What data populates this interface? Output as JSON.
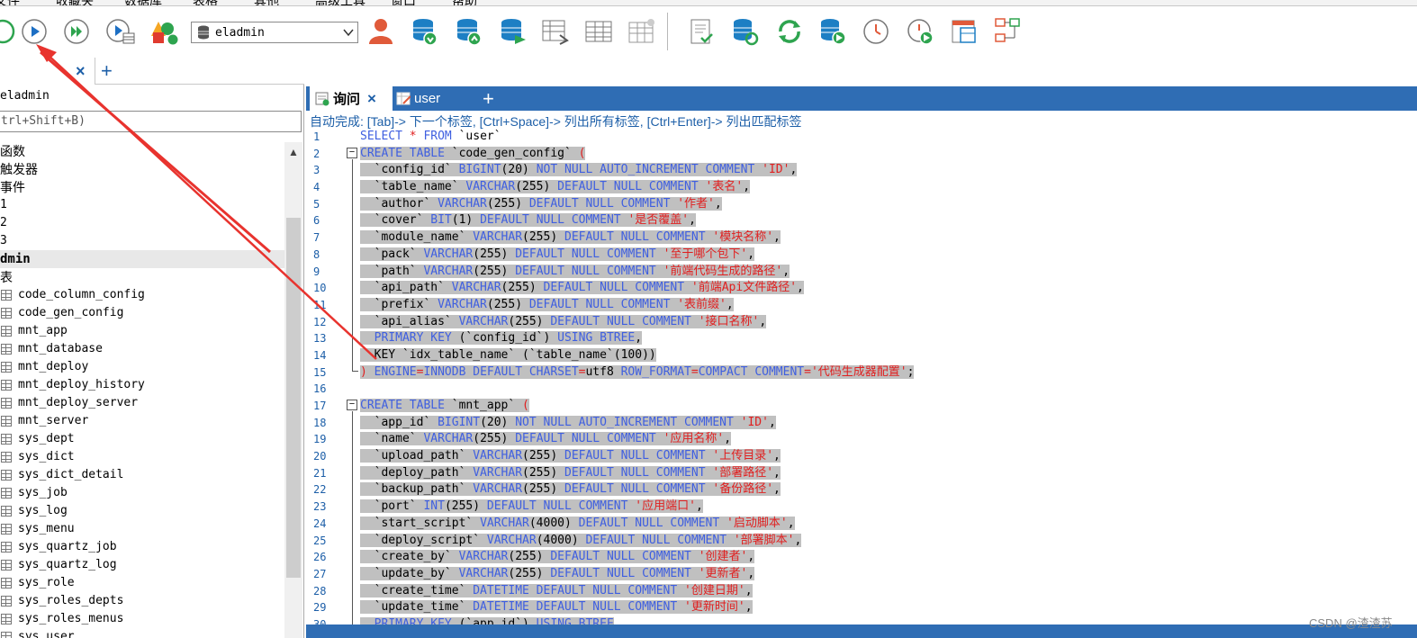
{
  "menubar": {
    "items": [
      "文件",
      "收藏夹",
      "数据库",
      "表格",
      "其他",
      "高级工具",
      "窗口",
      "帮助"
    ]
  },
  "toolbar": {
    "database_select": "eladmin",
    "icons": [
      "refresh-icon",
      "run-icon",
      "run-all-icon",
      "explain-icon",
      "shapes-icon",
      "user-icon",
      "db-import-icon",
      "db-export-icon",
      "db-sync-icon",
      "table-arrow-icon",
      "table-grid-icon",
      "table-star-icon",
      "doc-check-icon",
      "db-refresh-icon",
      "sync-icon",
      "db-add-icon",
      "clock-icon",
      "schedule-icon",
      "layout-icon",
      "diagram-icon"
    ]
  },
  "tabstrip2": {
    "close": "×",
    "plus": "+"
  },
  "left_panel": {
    "connection": "eladmin",
    "filter_placeholder": "trl+Shift+B)",
    "tree": [
      {
        "label": "函数",
        "style": "cjk"
      },
      {
        "label": "触发器",
        "style": "cjk"
      },
      {
        "label": "事件",
        "style": "cjk"
      },
      {
        "label": "1",
        "style": "mono"
      },
      {
        "label": "2",
        "style": "mono"
      },
      {
        "label": "3",
        "style": "mono"
      },
      {
        "label": "dmin",
        "style": "bold"
      },
      {
        "label": "表",
        "style": "cjk"
      },
      {
        "label": "code_column_config",
        "style": "table"
      },
      {
        "label": "code_gen_config",
        "style": "table"
      },
      {
        "label": "mnt_app",
        "style": "table"
      },
      {
        "label": "mnt_database",
        "style": "table"
      },
      {
        "label": "mnt_deploy",
        "style": "table"
      },
      {
        "label": "mnt_deploy_history",
        "style": "table"
      },
      {
        "label": "mnt_deploy_server",
        "style": "table"
      },
      {
        "label": "mnt_server",
        "style": "table"
      },
      {
        "label": "sys_dept",
        "style": "table"
      },
      {
        "label": "sys_dict",
        "style": "table"
      },
      {
        "label": "sys_dict_detail",
        "style": "table"
      },
      {
        "label": "sys_job",
        "style": "table"
      },
      {
        "label": "sys_log",
        "style": "table"
      },
      {
        "label": "sys_menu",
        "style": "table"
      },
      {
        "label": "sys_quartz_job",
        "style": "table"
      },
      {
        "label": "sys_quartz_log",
        "style": "table"
      },
      {
        "label": "sys_role",
        "style": "table"
      },
      {
        "label": "sys_roles_depts",
        "style": "table"
      },
      {
        "label": "sys_roles_menus",
        "style": "table"
      },
      {
        "label": "sys_user",
        "style": "table"
      }
    ]
  },
  "editor_tabs": {
    "active": "询问",
    "active_close": "×",
    "second": "user",
    "plus": "+"
  },
  "hint": "自动完成: [Tab]-> 下一个标签, [Ctrl+Space]-> 列出所有标签, [Ctrl+Enter]-> 列出匹配标签",
  "code_lines": [
    {
      "n": "1",
      "sel": false,
      "parts": [
        [
          "k",
          "SELECT "
        ],
        [
          "s",
          "* "
        ],
        [
          "k",
          "FROM "
        ],
        [
          "p",
          "`user`"
        ]
      ]
    },
    {
      "n": "2",
      "sel": true,
      "parts": [
        [
          "k",
          "CREATE TABLE "
        ],
        [
          "p",
          "`code_gen_config` "
        ],
        [
          "s",
          "("
        ]
      ]
    },
    {
      "n": "3",
      "sel": true,
      "parts": [
        [
          "p",
          "  `config_id` "
        ],
        [
          "k",
          "BIGINT"
        ],
        [
          "p",
          "(20) "
        ],
        [
          "k",
          "NOT NULL AUTO_INCREMENT COMMENT "
        ],
        [
          "s",
          "'ID'"
        ],
        [
          "p",
          ","
        ]
      ]
    },
    {
      "n": "4",
      "sel": true,
      "parts": [
        [
          "p",
          "  `table_name` "
        ],
        [
          "k",
          "VARCHAR"
        ],
        [
          "p",
          "(255) "
        ],
        [
          "k",
          "DEFAULT NULL COMMENT "
        ],
        [
          "s",
          "'表名'"
        ],
        [
          "p",
          ","
        ]
      ]
    },
    {
      "n": "5",
      "sel": true,
      "parts": [
        [
          "p",
          "  `author` "
        ],
        [
          "k",
          "VARCHAR"
        ],
        [
          "p",
          "(255) "
        ],
        [
          "k",
          "DEFAULT NULL COMMENT "
        ],
        [
          "s",
          "'作者'"
        ],
        [
          "p",
          ","
        ]
      ]
    },
    {
      "n": "6",
      "sel": true,
      "parts": [
        [
          "p",
          "  `cover` "
        ],
        [
          "k",
          "BIT"
        ],
        [
          "p",
          "(1) "
        ],
        [
          "k",
          "DEFAULT NULL COMMENT "
        ],
        [
          "s",
          "'是否覆盖'"
        ],
        [
          "p",
          ","
        ]
      ]
    },
    {
      "n": "7",
      "sel": true,
      "parts": [
        [
          "p",
          "  `module_name` "
        ],
        [
          "k",
          "VARCHAR"
        ],
        [
          "p",
          "(255) "
        ],
        [
          "k",
          "DEFAULT NULL COMMENT "
        ],
        [
          "s",
          "'模块名称'"
        ],
        [
          "p",
          ","
        ]
      ]
    },
    {
      "n": "8",
      "sel": true,
      "parts": [
        [
          "p",
          "  `pack` "
        ],
        [
          "k",
          "VARCHAR"
        ],
        [
          "p",
          "(255) "
        ],
        [
          "k",
          "DEFAULT NULL COMMENT "
        ],
        [
          "s",
          "'至于哪个包下'"
        ],
        [
          "p",
          ","
        ]
      ]
    },
    {
      "n": "9",
      "sel": true,
      "parts": [
        [
          "p",
          "  `path` "
        ],
        [
          "k",
          "VARCHAR"
        ],
        [
          "p",
          "(255) "
        ],
        [
          "k",
          "DEFAULT NULL COMMENT "
        ],
        [
          "s",
          "'前端代码生成的路径'"
        ],
        [
          "p",
          ","
        ]
      ]
    },
    {
      "n": "10",
      "sel": true,
      "parts": [
        [
          "p",
          "  `api_path` "
        ],
        [
          "k",
          "VARCHAR"
        ],
        [
          "p",
          "(255) "
        ],
        [
          "k",
          "DEFAULT NULL COMMENT "
        ],
        [
          "s",
          "'前端Api文件路径'"
        ],
        [
          "p",
          ","
        ]
      ]
    },
    {
      "n": "11",
      "sel": true,
      "parts": [
        [
          "p",
          "  `prefix` "
        ],
        [
          "k",
          "VARCHAR"
        ],
        [
          "p",
          "(255) "
        ],
        [
          "k",
          "DEFAULT NULL COMMENT "
        ],
        [
          "s",
          "'表前缀'"
        ],
        [
          "p",
          ","
        ]
      ]
    },
    {
      "n": "12",
      "sel": true,
      "parts": [
        [
          "p",
          "  `api_alias` "
        ],
        [
          "k",
          "VARCHAR"
        ],
        [
          "p",
          "(255) "
        ],
        [
          "k",
          "DEFAULT NULL COMMENT "
        ],
        [
          "s",
          "'接口名称'"
        ],
        [
          "p",
          ","
        ]
      ]
    },
    {
      "n": "13",
      "sel": true,
      "parts": [
        [
          "k",
          "  PRIMARY KEY "
        ],
        [
          "p",
          "(`config_id`) "
        ],
        [
          "k",
          "USING BTREE"
        ],
        [
          "p",
          ","
        ]
      ]
    },
    {
      "n": "14",
      "sel": true,
      "parts": [
        [
          "p",
          "  KEY `idx_table_name` (`table_name`(100))"
        ]
      ]
    },
    {
      "n": "15",
      "sel": true,
      "parts": [
        [
          "s",
          ") "
        ],
        [
          "k",
          "ENGINE"
        ],
        [
          "s",
          "="
        ],
        [
          "k",
          "INNODB DEFAULT CHARSET"
        ],
        [
          "s",
          "="
        ],
        [
          "p",
          "utf8 "
        ],
        [
          "k",
          "ROW_FORMAT"
        ],
        [
          "s",
          "="
        ],
        [
          "k",
          "COMPACT COMMENT"
        ],
        [
          "s",
          "="
        ],
        [
          "s",
          "'代码生成器配置'"
        ],
        [
          "p",
          ";"
        ]
      ]
    },
    {
      "n": "16",
      "sel": false,
      "parts": [
        [
          "p",
          ""
        ]
      ]
    },
    {
      "n": "17",
      "sel": true,
      "parts": [
        [
          "k",
          "CREATE TABLE "
        ],
        [
          "p",
          "`mnt_app` "
        ],
        [
          "s",
          "("
        ]
      ]
    },
    {
      "n": "18",
      "sel": true,
      "parts": [
        [
          "p",
          "  `app_id` "
        ],
        [
          "k",
          "BIGINT"
        ],
        [
          "p",
          "(20) "
        ],
        [
          "k",
          "NOT NULL AUTO_INCREMENT COMMENT "
        ],
        [
          "s",
          "'ID'"
        ],
        [
          "p",
          ","
        ]
      ]
    },
    {
      "n": "19",
      "sel": true,
      "parts": [
        [
          "p",
          "  `name` "
        ],
        [
          "k",
          "VARCHAR"
        ],
        [
          "p",
          "(255) "
        ],
        [
          "k",
          "DEFAULT NULL COMMENT "
        ],
        [
          "s",
          "'应用名称'"
        ],
        [
          "p",
          ","
        ]
      ]
    },
    {
      "n": "20",
      "sel": true,
      "parts": [
        [
          "p",
          "  `upload_path` "
        ],
        [
          "k",
          "VARCHAR"
        ],
        [
          "p",
          "(255) "
        ],
        [
          "k",
          "DEFAULT NULL COMMENT "
        ],
        [
          "s",
          "'上传目录'"
        ],
        [
          "p",
          ","
        ]
      ]
    },
    {
      "n": "21",
      "sel": true,
      "parts": [
        [
          "p",
          "  `deploy_path` "
        ],
        [
          "k",
          "VARCHAR"
        ],
        [
          "p",
          "(255) "
        ],
        [
          "k",
          "DEFAULT NULL COMMENT "
        ],
        [
          "s",
          "'部署路径'"
        ],
        [
          "p",
          ","
        ]
      ]
    },
    {
      "n": "22",
      "sel": true,
      "parts": [
        [
          "p",
          "  `backup_path` "
        ],
        [
          "k",
          "VARCHAR"
        ],
        [
          "p",
          "(255) "
        ],
        [
          "k",
          "DEFAULT NULL COMMENT "
        ],
        [
          "s",
          "'备份路径'"
        ],
        [
          "p",
          ","
        ]
      ]
    },
    {
      "n": "23",
      "sel": true,
      "parts": [
        [
          "p",
          "  `port` "
        ],
        [
          "k",
          "INT"
        ],
        [
          "p",
          "(255) "
        ],
        [
          "k",
          "DEFAULT NULL COMMENT "
        ],
        [
          "s",
          "'应用端口'"
        ],
        [
          "p",
          ","
        ]
      ]
    },
    {
      "n": "24",
      "sel": true,
      "parts": [
        [
          "p",
          "  `start_script` "
        ],
        [
          "k",
          "VARCHAR"
        ],
        [
          "p",
          "(4000) "
        ],
        [
          "k",
          "DEFAULT NULL COMMENT "
        ],
        [
          "s",
          "'启动脚本'"
        ],
        [
          "p",
          ","
        ]
      ]
    },
    {
      "n": "25",
      "sel": true,
      "parts": [
        [
          "p",
          "  `deploy_script` "
        ],
        [
          "k",
          "VARCHAR"
        ],
        [
          "p",
          "(4000) "
        ],
        [
          "k",
          "DEFAULT NULL COMMENT "
        ],
        [
          "s",
          "'部署脚本'"
        ],
        [
          "p",
          ","
        ]
      ]
    },
    {
      "n": "26",
      "sel": true,
      "parts": [
        [
          "p",
          "  `create_by` "
        ],
        [
          "k",
          "VARCHAR"
        ],
        [
          "p",
          "(255) "
        ],
        [
          "k",
          "DEFAULT NULL COMMENT "
        ],
        [
          "s",
          "'创建者'"
        ],
        [
          "p",
          ","
        ]
      ]
    },
    {
      "n": "27",
      "sel": true,
      "parts": [
        [
          "p",
          "  `update_by` "
        ],
        [
          "k",
          "VARCHAR"
        ],
        [
          "p",
          "(255) "
        ],
        [
          "k",
          "DEFAULT NULL COMMENT "
        ],
        [
          "s",
          "'更新者'"
        ],
        [
          "p",
          ","
        ]
      ]
    },
    {
      "n": "28",
      "sel": true,
      "parts": [
        [
          "p",
          "  `create_time` "
        ],
        [
          "k",
          "DATETIME DEFAULT NULL COMMENT "
        ],
        [
          "s",
          "'创建日期'"
        ],
        [
          "p",
          ","
        ]
      ]
    },
    {
      "n": "29",
      "sel": true,
      "parts": [
        [
          "p",
          "  `update_time` "
        ],
        [
          "k",
          "DATETIME DEFAULT NULL COMMENT "
        ],
        [
          "s",
          "'更新时间'"
        ],
        [
          "p",
          ","
        ]
      ]
    },
    {
      "n": "30",
      "sel": true,
      "parts": [
        [
          "k",
          "  PRIMARY KEY "
        ],
        [
          "p",
          "(`app_id`) "
        ],
        [
          "k",
          "USING BTREE"
        ]
      ]
    }
  ],
  "watermark": "CSDN @渣渣苏",
  "colors": {
    "accent_blue": "#2f6db4",
    "keyword": "#3f5fe0",
    "string": "#e02020",
    "selection": "#c0c0c0",
    "annotation_arrow": "#e8332e"
  }
}
